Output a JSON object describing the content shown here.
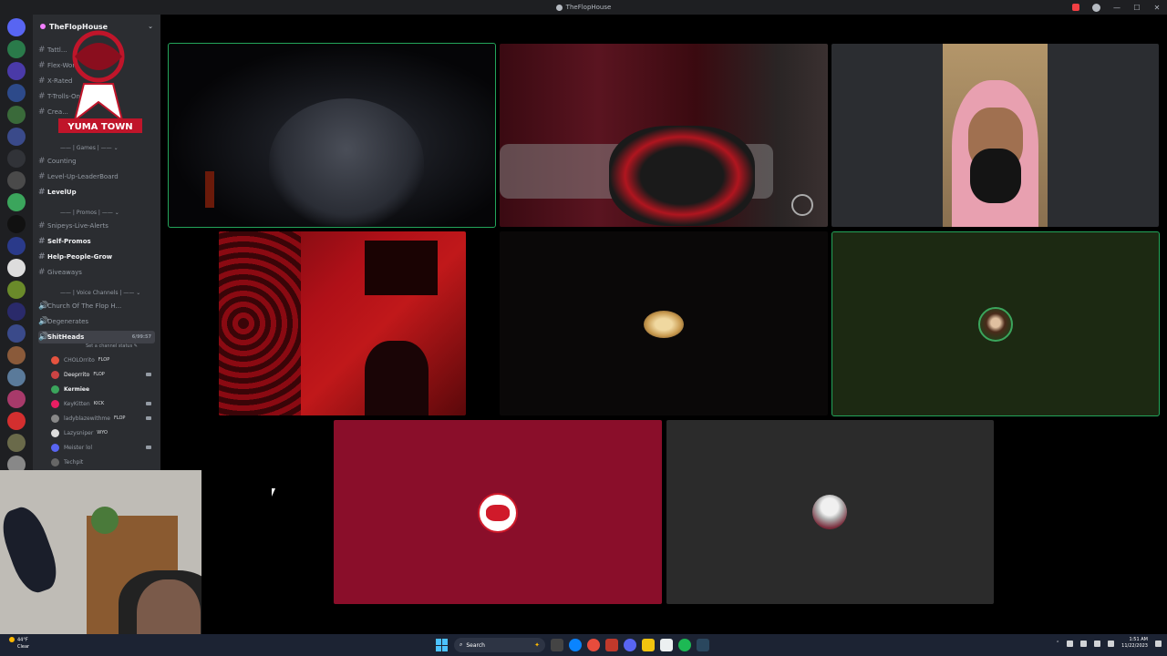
{
  "window": {
    "title": "TheFlopHouse"
  },
  "server": {
    "name": "TheFlopHouse"
  },
  "channels_top": [
    {
      "label": "Tattl..."
    },
    {
      "label": "Flex-Wor..."
    },
    {
      "label": "X-Rated"
    },
    {
      "label": "T-Trolls-Only"
    },
    {
      "label": "Crea..."
    }
  ],
  "categories": {
    "games": "—— | Games | —— ⌄",
    "promos": "—— | Promos | —— ⌄",
    "voice": "—— | Voice Channels | —— ⌄"
  },
  "channels_games": [
    {
      "label": "Counting"
    },
    {
      "label": "Level-Up-LeaderBoard"
    },
    {
      "label": "LevelUp"
    }
  ],
  "channels_promos": [
    {
      "label": "Snipeys-Live-Alerts"
    },
    {
      "label": "Self-Promos"
    },
    {
      "label": "Help-People-Grow"
    },
    {
      "label": "Giveaways"
    }
  ],
  "voice_channels": [
    {
      "label": "Church Of The Flop H..."
    },
    {
      "label": "Degenerates"
    },
    {
      "label": "ShitHeads",
      "count": "6/99:57"
    }
  ],
  "voice_status": "Set a channel status ✎",
  "voice_users": [
    {
      "name": "CHOLOrrito",
      "tag": "FLOP",
      "color": "#e5533f"
    },
    {
      "name": "Deeprrito",
      "tag": "FLOP",
      "color": "#c44"
    },
    {
      "name": "Kermiee",
      "tag": "",
      "color": "#3ba55c"
    },
    {
      "name": "KeyKitten",
      "tag": "KICK",
      "color": "#e91e63"
    },
    {
      "name": "ladyblazewithme",
      "tag": "FLOP",
      "color": "#888"
    },
    {
      "name": "Lazysniper",
      "tag": "WYO",
      "color": "#ddd"
    },
    {
      "name": "Meister lol",
      "tag": "",
      "color": "#5865f2"
    },
    {
      "name": "Techpit",
      "tag": "",
      "color": "#666"
    }
  ],
  "logo": {
    "text": "YUMA TOWN"
  },
  "taskbar": {
    "weather_temp": "44°F",
    "weather_desc": "Clear",
    "search_label": "Search",
    "time": "1:51 AM",
    "date": "11/22/2023"
  },
  "colors": {
    "speaking": "#23a55a",
    "crazydub_tile": "#8a0e2a",
    "green_tile": "#1c2912"
  }
}
